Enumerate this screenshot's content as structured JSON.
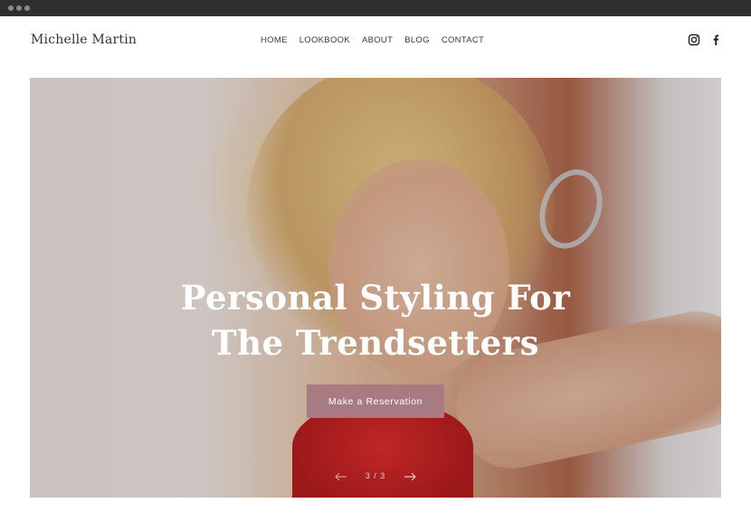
{
  "brand": {
    "name": "Michelle Martin"
  },
  "nav": {
    "items": [
      {
        "label": "HOME"
      },
      {
        "label": "LOOKBOOK"
      },
      {
        "label": "ABOUT"
      },
      {
        "label": "BLOG"
      },
      {
        "label": "CONTACT"
      }
    ]
  },
  "social": {
    "icons": [
      "instagram-icon",
      "facebook-icon"
    ],
    "color": "#222222"
  },
  "hero": {
    "title_line1": "Personal Styling For",
    "title_line2": "The Trendsetters",
    "button_label": "Make a Reservation",
    "button_color": "#a87b82",
    "slide_counter": "3 / 3"
  }
}
